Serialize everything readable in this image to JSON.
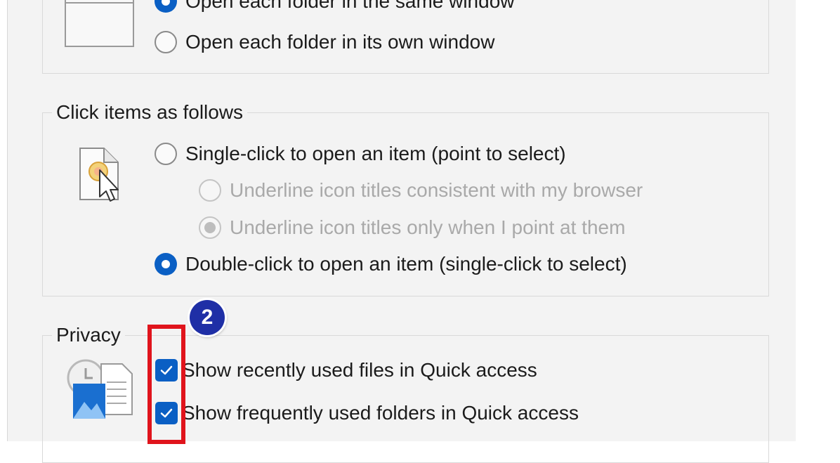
{
  "open_folders": {
    "same_window_label": "Open each folder in the same window",
    "own_window_label": "Open each folder in its own window",
    "selected": "same_window"
  },
  "click_items": {
    "title": "Click items as follows",
    "single_click_label": "Single-click to open an item (point to select)",
    "underline_browser_label": "Underline icon titles consistent with my browser",
    "underline_point_label": "Underline icon titles only when I point at them",
    "double_click_label": "Double-click to open an item (single-click to select)",
    "selected": "double_click"
  },
  "privacy": {
    "title": "Privacy",
    "recent_files_label": "Show recently used files in Quick access",
    "recent_files_checked": true,
    "frequent_folders_label": "Show frequently used folders in Quick access",
    "frequent_folders_checked": true
  },
  "annotation": {
    "step_number": "2",
    "accent_color": "#1f2fa6",
    "highlight_color": "#e0141c"
  },
  "colors": {
    "accent": "#0a5fc4",
    "panel_background": "#f3f3f3"
  }
}
